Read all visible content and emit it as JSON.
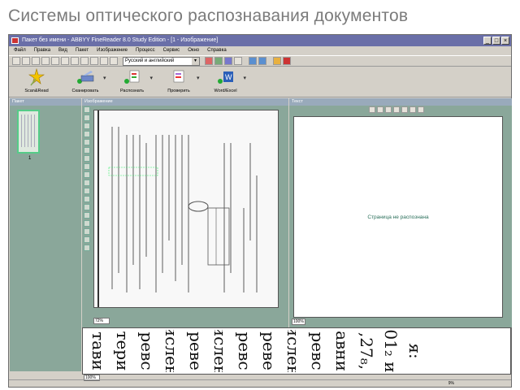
{
  "slide": {
    "title": "Системы оптического распознавания документов"
  },
  "window": {
    "title": "Пакет  без имени - ABBYY FineReader 8.0 Study Edition  - [1 - Изображение]",
    "buttons": [
      "_",
      "□",
      "×"
    ]
  },
  "menu": [
    "Файл",
    "Правка",
    "Вид",
    "Пакет",
    "Изображение",
    "Процесс",
    "Сервис",
    "Окно",
    "Справка"
  ],
  "toolbar": {
    "language_value": "Русский и английский"
  },
  "big_tools": [
    {
      "label": "Scan&Read",
      "icon": "star-wand-icon"
    },
    {
      "label": "Сканировать",
      "icon": "scanner-icon"
    },
    {
      "label": "Распознать",
      "icon": "recognize-icon"
    },
    {
      "label": "Проверить",
      "icon": "check-icon"
    },
    {
      "label": "Word/Excel",
      "icon": "word-export-icon"
    }
  ],
  "panels": {
    "pages_label": "Пакет",
    "image_label": "Изображение",
    "text_label": "Текст",
    "thumb_number": "1",
    "not_recognized": "Страница не распознана",
    "zoom_image": "72%",
    "zoom_text": "100%",
    "zoom_strip": "100%"
  },
  "zoom_strip_words": [
    "тави",
    "тери",
    "ревс",
    "ислен",
    "реве",
    "ислен",
    "ревс",
    "реве",
    "ислен",
    "ревс",
    "авни",
    ",27₈,",
    "01₂ и",
    "я:"
  ],
  "status": {
    "percent": "9%"
  },
  "colors": {
    "panel_green": "#8aa79a",
    "titlebar": "#6a6fa8"
  }
}
